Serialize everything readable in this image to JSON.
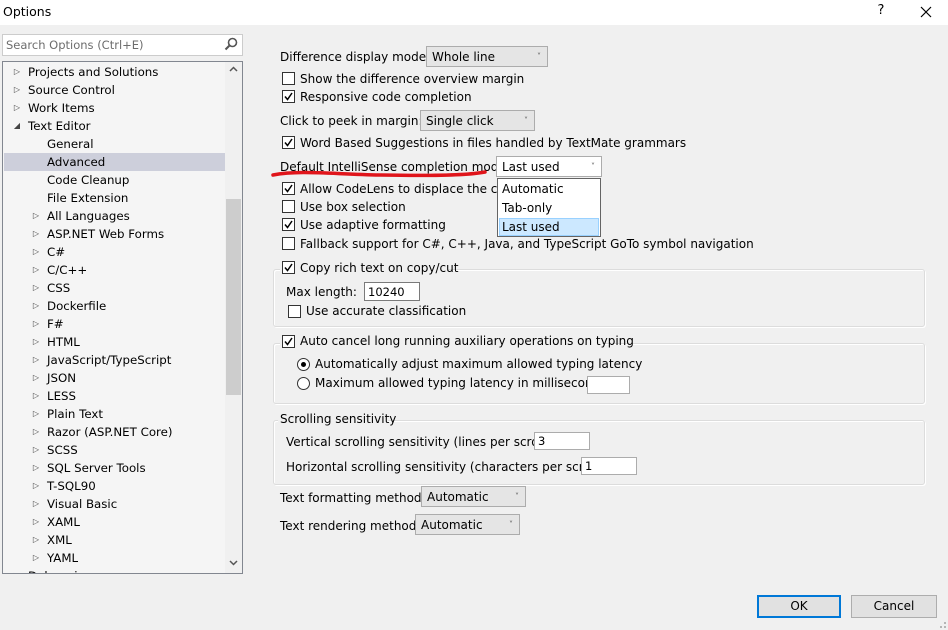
{
  "window": {
    "title": "Options",
    "help_label": "?",
    "close_label": "✕"
  },
  "search": {
    "placeholder": "Search Options (Ctrl+E)",
    "value": "",
    "icon": "search-icon"
  },
  "tree": {
    "items": [
      {
        "label": "Projects and Solutions",
        "level": 0,
        "state": "collapsed"
      },
      {
        "label": "Source Control",
        "level": 0,
        "state": "collapsed"
      },
      {
        "label": "Work Items",
        "level": 0,
        "state": "collapsed"
      },
      {
        "label": "Text Editor",
        "level": 0,
        "state": "expanded"
      },
      {
        "label": "General",
        "level": 1,
        "state": "leaf"
      },
      {
        "label": "Advanced",
        "level": 1,
        "state": "leaf",
        "selected": true
      },
      {
        "label": "Code Cleanup",
        "level": 1,
        "state": "leaf"
      },
      {
        "label": "File Extension",
        "level": 1,
        "state": "leaf"
      },
      {
        "label": "All Languages",
        "level": 1,
        "state": "collapsed"
      },
      {
        "label": "ASP.NET Web Forms",
        "level": 1,
        "state": "collapsed"
      },
      {
        "label": "C#",
        "level": 1,
        "state": "collapsed"
      },
      {
        "label": "C/C++",
        "level": 1,
        "state": "collapsed"
      },
      {
        "label": "CSS",
        "level": 1,
        "state": "collapsed"
      },
      {
        "label": "Dockerfile",
        "level": 1,
        "state": "collapsed"
      },
      {
        "label": "F#",
        "level": 1,
        "state": "collapsed"
      },
      {
        "label": "HTML",
        "level": 1,
        "state": "collapsed"
      },
      {
        "label": "JavaScript/TypeScript",
        "level": 1,
        "state": "collapsed"
      },
      {
        "label": "JSON",
        "level": 1,
        "state": "collapsed"
      },
      {
        "label": "LESS",
        "level": 1,
        "state": "collapsed"
      },
      {
        "label": "Plain Text",
        "level": 1,
        "state": "collapsed"
      },
      {
        "label": "Razor (ASP.NET Core)",
        "level": 1,
        "state": "collapsed"
      },
      {
        "label": "SCSS",
        "level": 1,
        "state": "collapsed"
      },
      {
        "label": "SQL Server Tools",
        "level": 1,
        "state": "collapsed"
      },
      {
        "label": "T-SQL90",
        "level": 1,
        "state": "collapsed"
      },
      {
        "label": "Visual Basic",
        "level": 1,
        "state": "collapsed"
      },
      {
        "label": "XAML",
        "level": 1,
        "state": "collapsed"
      },
      {
        "label": "XML",
        "level": 1,
        "state": "collapsed"
      },
      {
        "label": "YAML",
        "level": 1,
        "state": "collapsed"
      },
      {
        "label": "Debugging",
        "level": 0,
        "state": "collapsed"
      }
    ],
    "scroll_up_icon": "˄",
    "scroll_down_icon": "˅"
  },
  "settings": {
    "difference_display_mode": {
      "label": "Difference display mode:",
      "value": "Whole line"
    },
    "show_difference_overview_margin": {
      "label": "Show the difference overview margin",
      "checked": false
    },
    "responsive_code_completion": {
      "label": "Responsive code completion",
      "checked": true
    },
    "click_to_peek": {
      "label": "Click to peek in margin:",
      "value": "Single click"
    },
    "word_based_suggestions": {
      "label": "Word Based Suggestions in files handled by TextMate grammars",
      "checked": true
    },
    "intellisense_mode": {
      "label": "Default IntelliSense completion mode:",
      "value": "Last used",
      "options": [
        "Automatic",
        "Tab-only",
        "Last used"
      ],
      "highlighted": "Last used",
      "annotation_color": "#e0151b"
    },
    "allow_codelens": {
      "label": "Allow CodeLens to displace the caret",
      "checked": true
    },
    "box_selection": {
      "label": "Use box selection",
      "checked": false
    },
    "adaptive_formatting": {
      "label": "Use adaptive formatting",
      "checked": true
    },
    "fallback_goto": {
      "label": "Fallback support for C#, C++, Java, and TypeScript GoTo symbol navigation",
      "checked": false
    },
    "copy_rich_text": {
      "label": "Copy rich text on copy/cut",
      "checked": true,
      "max_length_label": "Max length:",
      "max_length_value": "10240",
      "accurate_classification": {
        "label": "Use accurate classification",
        "checked": false
      }
    },
    "auto_cancel": {
      "label": "Auto cancel long running auxiliary operations on typing",
      "checked": true,
      "auto_adjust": {
        "label": "Automatically adjust maximum allowed typing latency",
        "selected": true
      },
      "max_latency": {
        "label": "Maximum allowed typing latency in milliseconds:",
        "selected": false,
        "value": ""
      }
    },
    "scrolling": {
      "title": "Scrolling sensitivity",
      "vertical_label": "Vertical scrolling sensitivity (lines per scroll):",
      "vertical_value": "3",
      "horizontal_label": "Horizontal scrolling sensitivity (characters per scroll):",
      "horizontal_value": "1"
    },
    "text_formatting_method": {
      "label": "Text formatting method",
      "value": "Automatic"
    },
    "text_rendering_method": {
      "label": "Text rendering method",
      "value": "Automatic"
    }
  },
  "buttons": {
    "ok": "OK",
    "cancel": "Cancel"
  },
  "icons": {
    "chevron": "˅",
    "tree_collapsed": "▷",
    "tree_expanded": "◢"
  }
}
